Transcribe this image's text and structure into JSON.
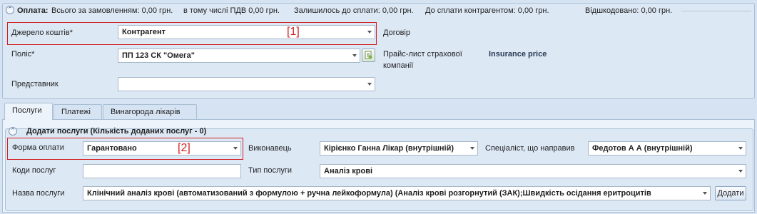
{
  "payment": {
    "title": "Оплата:",
    "totals": [
      "Всього за замовленням: 0,00 грн.",
      "в тому числі ПДВ 0,00 грн.",
      "Залишилось до сплати: 0,00 грн.",
      "До сплати контрагентом: 0,00 грн.",
      "Відшкодовано: 0,00 грн."
    ],
    "source_label": "Джерело коштів*",
    "source_value": "Контрагент",
    "contract_label": "Договір",
    "policy_label": "Поліс*",
    "policy_value": "ПП 123 СК \"Омега\"",
    "pricelist_label_line1": "Прайс-лист страхової",
    "pricelist_label_line2": "компанії",
    "pricelist_value": "Insurance price",
    "representative_label": "Представник",
    "representative_value": ""
  },
  "tabs": [
    {
      "label": "Послуги",
      "active": true
    },
    {
      "label": "Платежі",
      "active": false
    },
    {
      "label": "Винагорода лікарів",
      "active": false
    }
  ],
  "services": {
    "title": "Додати послуги (Кількість доданих послуг - 0)",
    "payment_form_label": "Форма оплати",
    "payment_form_value": "Гарантовано",
    "performer_label": "Виконавець",
    "performer_value": "Кірієнко Ганна Лікар (внутрішній)",
    "referrer_label": "Спеціаліст, що направив",
    "referrer_value": "Федотов А А (внутрішній)",
    "codes_label": "Коди послуг",
    "codes_value": "",
    "service_type_label": "Тип послуги",
    "service_type_value": "Аналіз крові",
    "service_name_label": "Назва послуги",
    "service_name_value": "Клінічний аналіз крові (автоматизований з формулою + ручна лейкоформула) (Аналіз крові розгорнутий (ЗАК);Швидкість осідання еритроцитів",
    "add_button": "Додати"
  },
  "annotations": {
    "marker1": "[1]",
    "marker2": "[2]"
  }
}
